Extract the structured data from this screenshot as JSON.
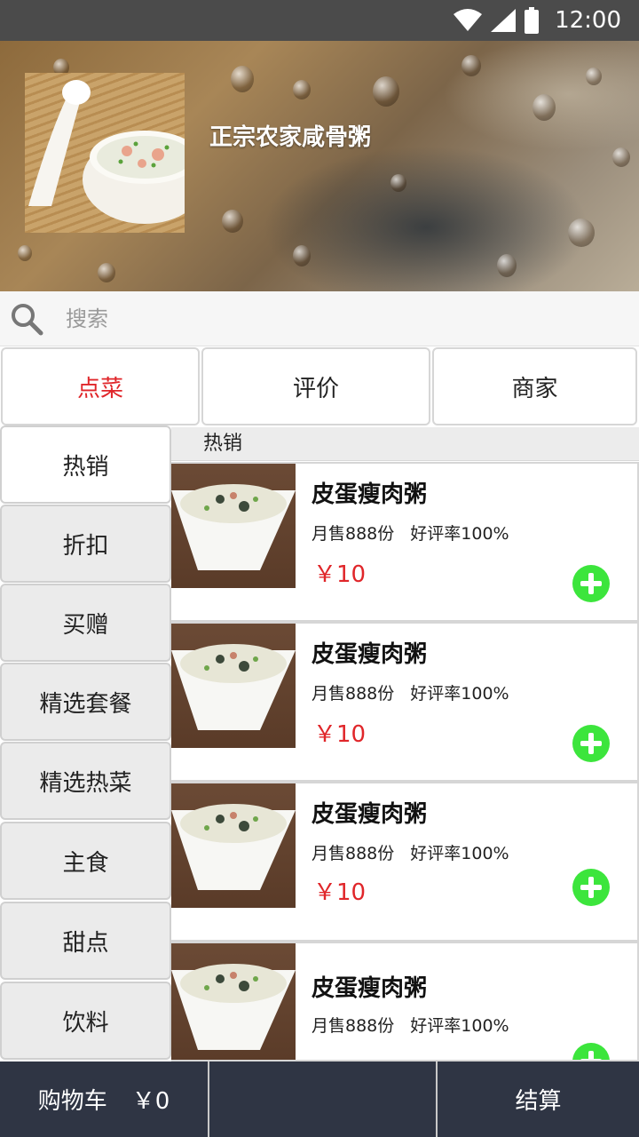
{
  "status_bar": {
    "time": "12:00"
  },
  "shop": {
    "name": "正宗农家咸骨粥"
  },
  "search": {
    "placeholder": "搜索"
  },
  "tabs": [
    {
      "label": "点菜",
      "active": true
    },
    {
      "label": "评价",
      "active": false
    },
    {
      "label": "商家",
      "active": false
    }
  ],
  "categories": [
    {
      "label": "热销",
      "active": true
    },
    {
      "label": "折扣"
    },
    {
      "label": "买赠"
    },
    {
      "label": "精选套餐"
    },
    {
      "label": "精选热菜"
    },
    {
      "label": "主食"
    },
    {
      "label": "甜点"
    },
    {
      "label": "饮料"
    }
  ],
  "section": {
    "title": "热销"
  },
  "dishes": [
    {
      "name": "皮蛋瘦肉粥",
      "sales": "月售888份",
      "rating": "好评率100%",
      "price": "￥10"
    },
    {
      "name": "皮蛋瘦肉粥",
      "sales": "月售888份",
      "rating": "好评率100%",
      "price": "￥10"
    },
    {
      "name": "皮蛋瘦肉粥",
      "sales": "月售888份",
      "rating": "好评率100%",
      "price": "￥10"
    },
    {
      "name": "皮蛋瘦肉粥",
      "sales": "月售888份",
      "rating": "好评率100%",
      "price": ""
    }
  ],
  "bottom_bar": {
    "cart_label": "购物车",
    "cart_total": "￥0",
    "checkout_label": "结算"
  },
  "colors": {
    "accent_red": "#e0262a",
    "add_green": "#3ce53c",
    "bottom_bar": "#2f3544",
    "status_bar": "#4b4b4b"
  },
  "icons": [
    "wifi-icon",
    "cellular-signal-icon",
    "battery-icon",
    "search-icon",
    "add-circle-icon"
  ]
}
